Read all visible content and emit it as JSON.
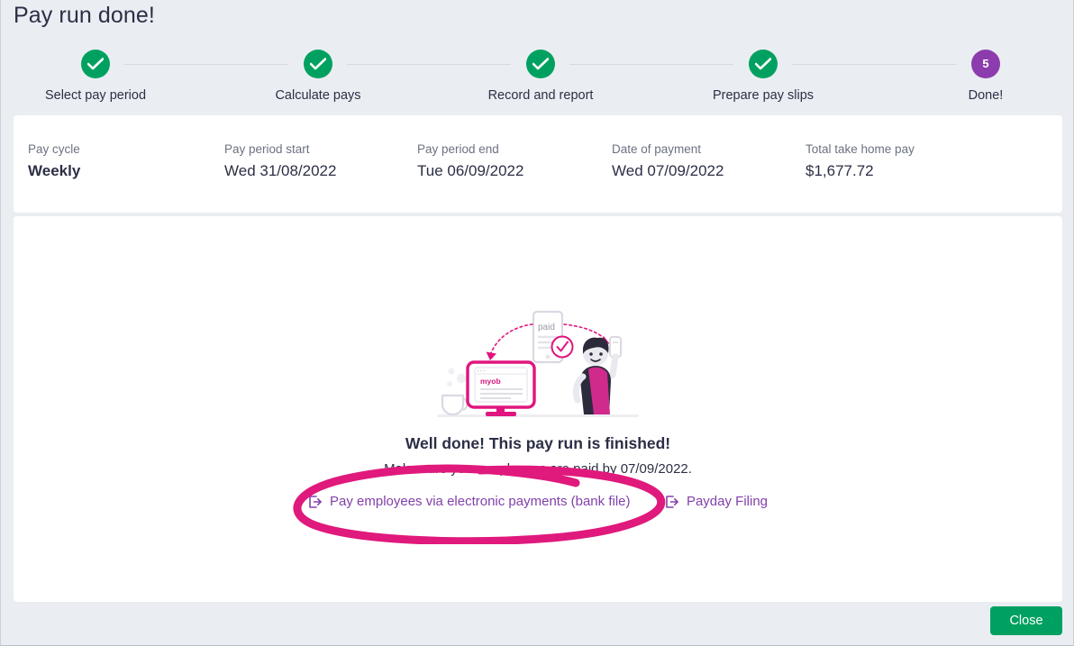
{
  "window": {
    "title": "Pay run done!",
    "background_color": "#eaeef2"
  },
  "theme": {
    "green": "#00a160",
    "purple": "#8c3cad",
    "link_purple": "#8241aa",
    "annotation_pink": "#e0197c",
    "text_dark": "#2c2f45",
    "label_gray": "#6b7280"
  },
  "stepper": {
    "steps": [
      {
        "label": "Select pay period",
        "state": "done",
        "marker": "check-icon"
      },
      {
        "label": "Calculate pays",
        "state": "done",
        "marker": "check-icon"
      },
      {
        "label": "Record and report",
        "state": "done",
        "marker": "check-icon"
      },
      {
        "label": "Prepare pay slips",
        "state": "done",
        "marker": "check-icon"
      },
      {
        "label": "Done!",
        "state": "current",
        "marker": "5"
      }
    ]
  },
  "summary": {
    "fields": [
      {
        "label": "Pay cycle",
        "value": "Weekly",
        "emphasis": true
      },
      {
        "label": "Pay period start",
        "value": "Wed 31/08/2022",
        "emphasis": false
      },
      {
        "label": "Pay period end",
        "value": "Tue 06/09/2022",
        "emphasis": false
      },
      {
        "label": "Date of payment",
        "value": "Wed 07/09/2022",
        "emphasis": false
      },
      {
        "label": "Total take home pay",
        "value": "$1,677.72",
        "emphasis": false
      }
    ]
  },
  "main": {
    "illustration": {
      "name": "pay-run-complete-illustration",
      "phone_label": "paid",
      "monitor_brand": "myob"
    },
    "headline": "Well done! This pay run is finished!",
    "subline": "Make sure your employees are paid by 07/09/2022.",
    "links": [
      {
        "label": "Pay employees via electronic payments (bank file)",
        "icon": "external-link-icon"
      },
      {
        "label": "Payday Filing",
        "icon": "external-link-icon"
      }
    ]
  },
  "annotation": {
    "shape": "hand-drawn-ellipse",
    "color": "#e0197c",
    "targets": "Pay employees via electronic payments (bank file)"
  },
  "footer": {
    "close_label": "Close"
  }
}
